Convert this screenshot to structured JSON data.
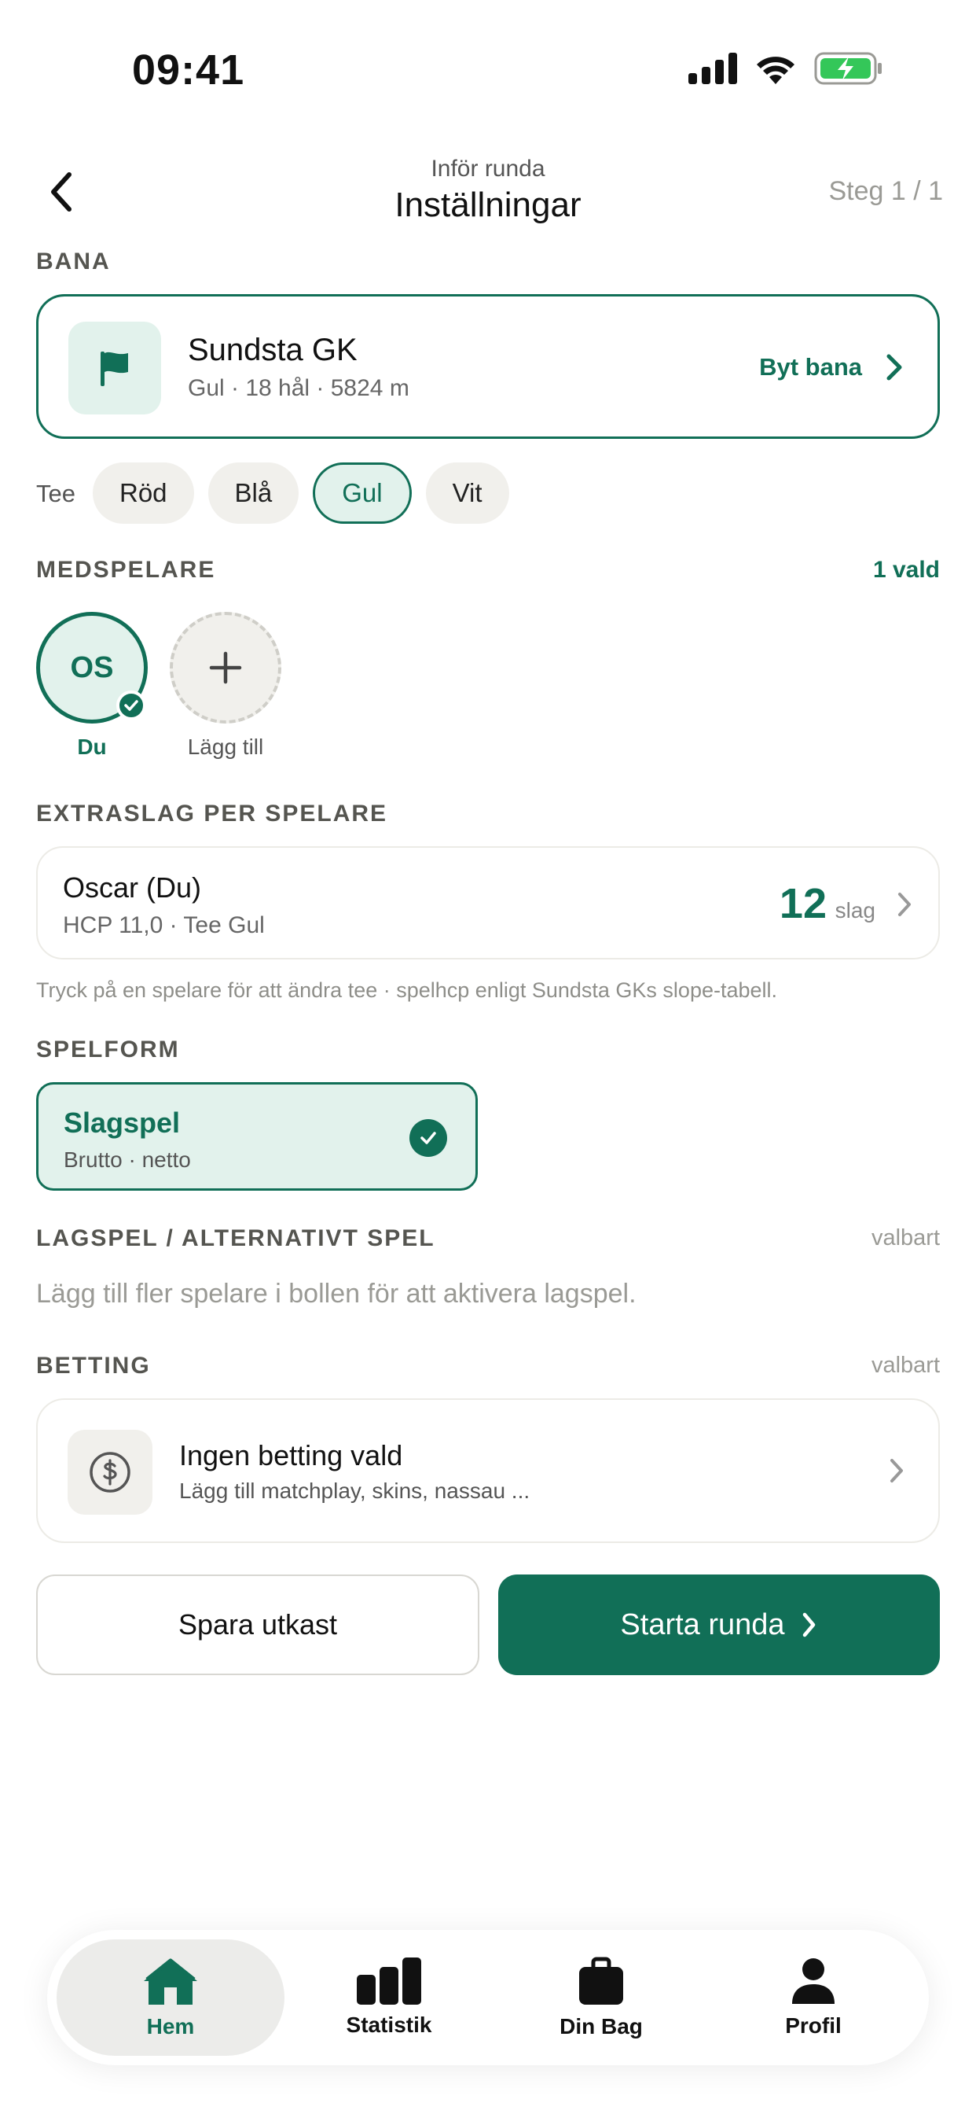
{
  "status_bar": {
    "time": "09:41"
  },
  "header": {
    "subtitle": "Inför runda",
    "title": "Inställningar",
    "step": "Steg 1 / 1"
  },
  "course": {
    "section_label": "BANA",
    "name": "Sundsta GK",
    "info": "Gul · 18 hål · 5824 m",
    "change_label": "Byt bana",
    "icon": "flag-icon"
  },
  "tee": {
    "label": "Tee",
    "options": [
      "Röd",
      "Blå",
      "Gul",
      "Vit"
    ],
    "selected": "Gul"
  },
  "players": {
    "section_label": "MEDSPELARE",
    "selected_count": "1 vald",
    "me": {
      "initials": "OS",
      "name": "Du"
    },
    "add_label": "Lägg till"
  },
  "handicap": {
    "section_label": "EXTRASLAG PER SPELARE",
    "player_name": "Oscar (Du)",
    "player_info": "HCP 11,0 · Tee Gul",
    "strokes": "12",
    "strokes_unit": "slag",
    "hint": "Tryck på en spelare för att ändra tee · spelhcp enligt Sundsta GKs slope-tabell."
  },
  "format": {
    "section_label": "SPELFORM",
    "name": "Slagspel",
    "sub": "Brutto · netto"
  },
  "team": {
    "section_label": "LAGSPEL / ALTERNATIVT SPEL",
    "optional": "valbart",
    "hint": "Lägg till fler spelare i bollen för att aktivera lagspel."
  },
  "betting": {
    "section_label": "BETTING",
    "optional": "valbart",
    "title": "Ingen betting vald",
    "sub": "Lägg till matchplay, skins, nassau ...",
    "icon": "dollar-icon"
  },
  "actions": {
    "draft": "Spara utkast",
    "start": "Starta runda"
  },
  "tabbar": {
    "items": [
      {
        "label": "Hem",
        "icon": "home-icon",
        "active": true
      },
      {
        "label": "Statistik",
        "icon": "chart-icon",
        "active": false
      },
      {
        "label": "Din Bag",
        "icon": "bag-icon",
        "active": false
      },
      {
        "label": "Profil",
        "icon": "person-icon",
        "active": false
      }
    ]
  },
  "colors": {
    "accent": "#116f57",
    "accent_light": "#e2f2ec",
    "chip_bg": "#f1f0ec"
  }
}
